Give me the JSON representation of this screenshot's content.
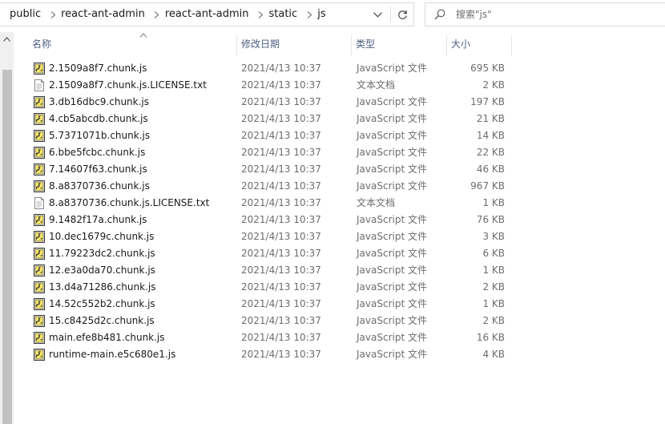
{
  "address_bar": {
    "breadcrumbs": [
      {
        "label": "public"
      },
      {
        "label": "react-ant-admin"
      },
      {
        "label": "react-ant-admin"
      },
      {
        "label": "static"
      },
      {
        "label": "js"
      }
    ]
  },
  "search": {
    "placeholder": "搜索\"js\"",
    "value": ""
  },
  "columns": {
    "name": "名称",
    "date": "修改日期",
    "type": "类型",
    "size": "大小",
    "sorted_by": "name"
  },
  "files": [
    {
      "name": "2.1509a8f7.chunk.js",
      "date": "2021/4/13 10:37",
      "type": "JavaScript 文件",
      "size": "695 KB",
      "icon": "js-file-icon"
    },
    {
      "name": "2.1509a8f7.chunk.js.LICENSE.txt",
      "date": "2021/4/13 10:37",
      "type": "文本文档",
      "size": "2 KB",
      "icon": "text-file-icon"
    },
    {
      "name": "3.db16dbc9.chunk.js",
      "date": "2021/4/13 10:37",
      "type": "JavaScript 文件",
      "size": "197 KB",
      "icon": "js-file-icon"
    },
    {
      "name": "4.cb5abcdb.chunk.js",
      "date": "2021/4/13 10:37",
      "type": "JavaScript 文件",
      "size": "21 KB",
      "icon": "js-file-icon"
    },
    {
      "name": "5.7371071b.chunk.js",
      "date": "2021/4/13 10:37",
      "type": "JavaScript 文件",
      "size": "14 KB",
      "icon": "js-file-icon"
    },
    {
      "name": "6.bbe5fcbc.chunk.js",
      "date": "2021/4/13 10:37",
      "type": "JavaScript 文件",
      "size": "22 KB",
      "icon": "js-file-icon"
    },
    {
      "name": "7.14607f63.chunk.js",
      "date": "2021/4/13 10:37",
      "type": "JavaScript 文件",
      "size": "46 KB",
      "icon": "js-file-icon"
    },
    {
      "name": "8.a8370736.chunk.js",
      "date": "2021/4/13 10:37",
      "type": "JavaScript 文件",
      "size": "967 KB",
      "icon": "js-file-icon"
    },
    {
      "name": "8.a8370736.chunk.js.LICENSE.txt",
      "date": "2021/4/13 10:37",
      "type": "文本文档",
      "size": "1 KB",
      "icon": "text-file-icon"
    },
    {
      "name": "9.1482f17a.chunk.js",
      "date": "2021/4/13 10:37",
      "type": "JavaScript 文件",
      "size": "76 KB",
      "icon": "js-file-icon"
    },
    {
      "name": "10.dec1679c.chunk.js",
      "date": "2021/4/13 10:37",
      "type": "JavaScript 文件",
      "size": "3 KB",
      "icon": "js-file-icon"
    },
    {
      "name": "11.79223dc2.chunk.js",
      "date": "2021/4/13 10:37",
      "type": "JavaScript 文件",
      "size": "6 KB",
      "icon": "js-file-icon"
    },
    {
      "name": "12.e3a0da70.chunk.js",
      "date": "2021/4/13 10:37",
      "type": "JavaScript 文件",
      "size": "1 KB",
      "icon": "js-file-icon"
    },
    {
      "name": "13.d4a71286.chunk.js",
      "date": "2021/4/13 10:37",
      "type": "JavaScript 文件",
      "size": "2 KB",
      "icon": "js-file-icon"
    },
    {
      "name": "14.52c552b2.chunk.js",
      "date": "2021/4/13 10:37",
      "type": "JavaScript 文件",
      "size": "1 KB",
      "icon": "js-file-icon"
    },
    {
      "name": "15.c8425d2c.chunk.js",
      "date": "2021/4/13 10:37",
      "type": "JavaScript 文件",
      "size": "2 KB",
      "icon": "js-file-icon"
    },
    {
      "name": "main.efe8b481.chunk.js",
      "date": "2021/4/13 10:37",
      "type": "JavaScript 文件",
      "size": "16 KB",
      "icon": "js-file-icon"
    },
    {
      "name": "runtime-main.e5c680e1.js",
      "date": "2021/4/13 10:37",
      "type": "JavaScript 文件",
      "size": "4 KB",
      "icon": "js-file-icon"
    }
  ],
  "colors": {
    "header_text": "#4d6082",
    "secondary_text": "#6d6d6d",
    "js_icon_yellow": "#f3e46a",
    "scrollbar_thumb": "#c2c2c2"
  }
}
